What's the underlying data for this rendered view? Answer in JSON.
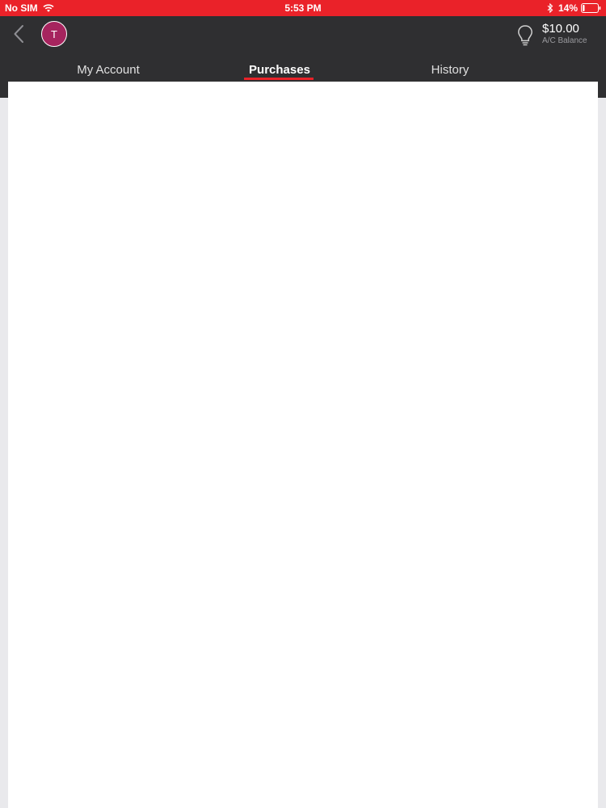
{
  "status_bar": {
    "carrier": "No SIM",
    "time": "5:53 PM",
    "battery_percent": "14%",
    "battery_level": 0.14,
    "wifi_icon": "wifi-icon",
    "bluetooth_icon": "bluetooth-icon",
    "battery_icon": "battery-icon",
    "background_color": "#ea2229"
  },
  "header": {
    "back_icon": "chevron-left-icon",
    "avatar_initial": "T",
    "avatar_color": "#a6245e",
    "tip_icon": "lightbulb-icon",
    "balance_amount": "$10.00",
    "balance_label": "A/C Balance",
    "background_color": "#2f2f31"
  },
  "tabs": [
    {
      "label": "My Account",
      "active": false
    },
    {
      "label": "Purchases",
      "active": true
    },
    {
      "label": "History",
      "active": false
    }
  ],
  "accent_color": "#ea2229"
}
